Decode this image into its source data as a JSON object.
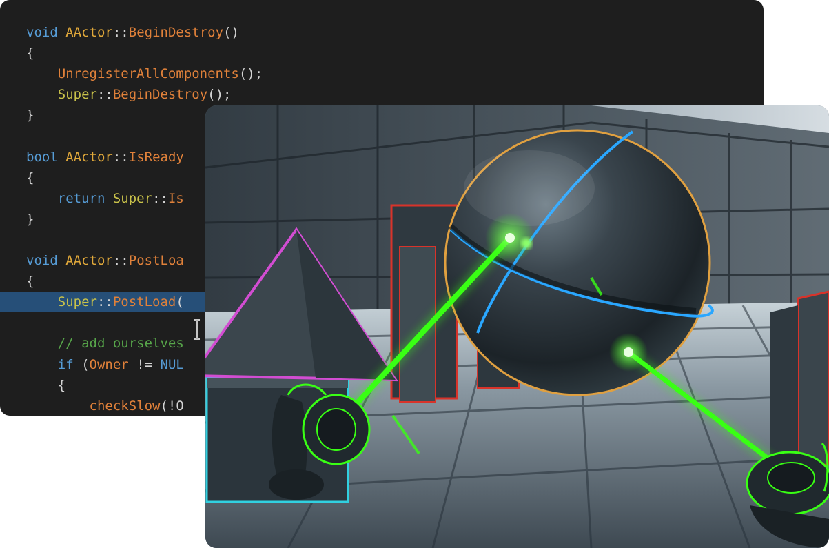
{
  "code": {
    "lines": [
      [
        {
          "c": "kw",
          "t": "void"
        },
        {
          "c": "op",
          "t": " "
        },
        {
          "c": "ty",
          "t": "AActor"
        },
        {
          "c": "op",
          "t": "::"
        },
        {
          "c": "fn",
          "t": "BeginDestroy"
        },
        {
          "c": "op",
          "t": "()"
        }
      ],
      [
        {
          "c": "op",
          "t": "{"
        }
      ],
      [
        {
          "c": "op",
          "t": "    "
        },
        {
          "c": "fn",
          "t": "UnregisterAllComponents"
        },
        {
          "c": "op",
          "t": "();"
        }
      ],
      [
        {
          "c": "op",
          "t": "    "
        },
        {
          "c": "cls",
          "t": "Super"
        },
        {
          "c": "op",
          "t": "::"
        },
        {
          "c": "fn",
          "t": "BeginDestroy"
        },
        {
          "c": "op",
          "t": "();"
        }
      ],
      [
        {
          "c": "op",
          "t": "}"
        }
      ],
      [],
      [
        {
          "c": "kw",
          "t": "bool"
        },
        {
          "c": "op",
          "t": " "
        },
        {
          "c": "ty",
          "t": "AActor"
        },
        {
          "c": "op",
          "t": "::"
        },
        {
          "c": "fn",
          "t": "IsReady"
        }
      ],
      [
        {
          "c": "op",
          "t": "{"
        }
      ],
      [
        {
          "c": "op",
          "t": "    "
        },
        {
          "c": "kw",
          "t": "return"
        },
        {
          "c": "op",
          "t": " "
        },
        {
          "c": "cls",
          "t": "Super"
        },
        {
          "c": "op",
          "t": "::"
        },
        {
          "c": "fn",
          "t": "Is"
        }
      ],
      [
        {
          "c": "op",
          "t": "}"
        }
      ],
      [],
      [
        {
          "c": "kw",
          "t": "void"
        },
        {
          "c": "op",
          "t": " "
        },
        {
          "c": "ty",
          "t": "AActor"
        },
        {
          "c": "op",
          "t": "::"
        },
        {
          "c": "fn",
          "t": "PostLoa"
        }
      ],
      [
        {
          "c": "op",
          "t": "{"
        }
      ],
      [
        {
          "c": "op",
          "t": "    "
        },
        {
          "c": "cls",
          "t": "Super"
        },
        {
          "c": "op",
          "t": "::"
        },
        {
          "c": "fn",
          "t": "PostLoad"
        },
        {
          "c": "op",
          "t": "("
        }
      ],
      [],
      [
        {
          "c": "op",
          "t": "    "
        },
        {
          "c": "cm",
          "t": "// add ourselves"
        }
      ],
      [
        {
          "c": "op",
          "t": "    "
        },
        {
          "c": "kw",
          "t": "if"
        },
        {
          "c": "op",
          "t": " ("
        },
        {
          "c": "fn",
          "t": "Owner"
        },
        {
          "c": "op",
          "t": " != "
        },
        {
          "c": "kw",
          "t": "NUL"
        }
      ],
      [
        {
          "c": "op",
          "t": "    {"
        }
      ],
      [
        {
          "c": "op",
          "t": "        "
        },
        {
          "c": "fn",
          "t": "checkSlow"
        },
        {
          "c": "op",
          "t": "(!O"
        }
      ]
    ],
    "highlighted_line": 13
  },
  "icons": {
    "text_cursor": "i-beam-cursor-icon",
    "left_controller": "vr-motion-controller-icon",
    "right_controller": "vr-motion-controller-icon"
  },
  "colors": {
    "editor_bg": "#1e1e1e",
    "laser": "#39ff14",
    "sphere_seam": "#2aa7ff",
    "selection_outline": "#e0a040",
    "triangle_outline": "#d24dd2",
    "pillar_outline": "#d8332a",
    "box_outline": "#31d0e0"
  }
}
